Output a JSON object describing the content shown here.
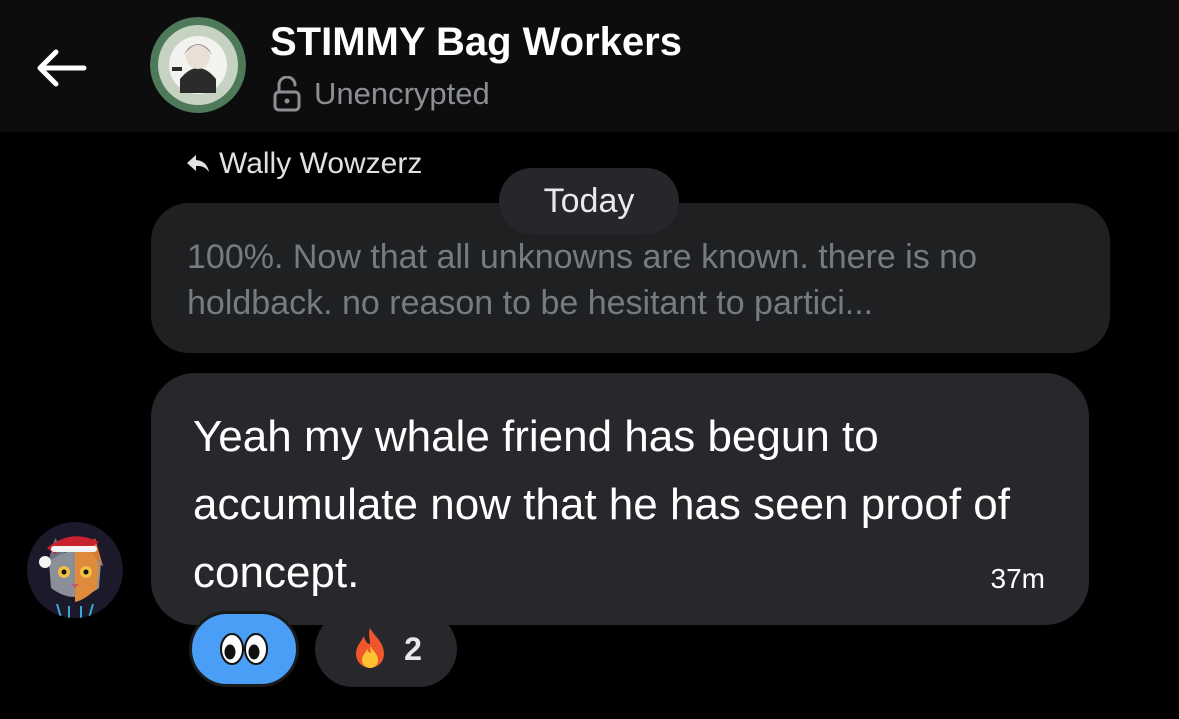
{
  "header": {
    "title": "STIMMY Bag Workers",
    "encryption_status": "Unencrypted"
  },
  "reply": {
    "to_name": "Wally Wowzerz",
    "quoted_text": "100%. Now that all unknowns are known. there is no holdback. no reason to be hesitant to partici..."
  },
  "date_separator": "Today",
  "message": {
    "text": "Yeah my whale friend has begun to accumulate now that he has seen proof of concept.",
    "time": "37m"
  },
  "reactions": [
    {
      "emoji": "eyes",
      "count": ""
    },
    {
      "emoji": "fire",
      "count": "2"
    }
  ],
  "icons": {
    "back": "back-arrow-icon",
    "lock": "unlocked-padlock-icon",
    "reply": "reply-arrow-icon"
  },
  "colors": {
    "background": "#000000",
    "header_bg": "#0d0d0d",
    "bubble_bg": "#26282b",
    "quoted_bg": "#1f2022",
    "active_reaction": "#4a9ef5"
  }
}
